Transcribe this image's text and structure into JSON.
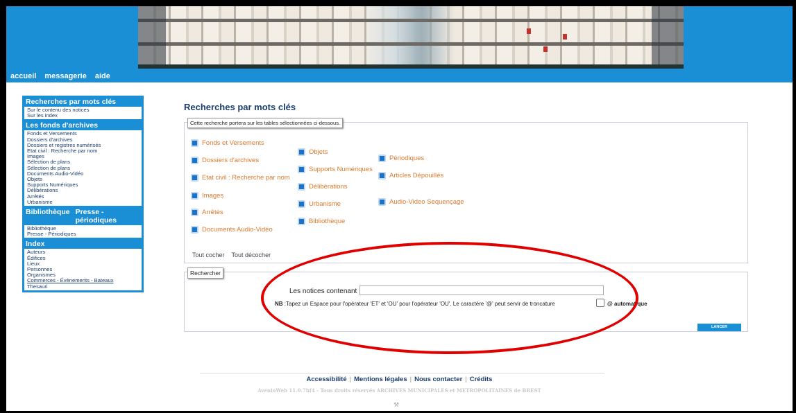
{
  "topnav": [
    "accueil",
    "messagerie",
    "aide"
  ],
  "sidebar": {
    "sections": [
      {
        "title": "Recherches par mots clés",
        "items": [
          "Sur le contenu des notices",
          "Sur les index"
        ]
      },
      {
        "title": "Les fonds d'archives",
        "items": [
          "Fonds et Versements",
          "Dossiers d'archives",
          "Dossiers et registres numérisés",
          "Etat civil : Recherche par nom",
          "Images",
          "Sélection de plans",
          "Sélection de plans",
          "Documents Audio-Vidéo",
          "Objets",
          "Supports Numériques",
          "Délibérations",
          "Arrêtés",
          "Urbanisme"
        ]
      },
      {
        "title_left": "Bibliothèque",
        "title_right": "Presse - périodiques",
        "items": [
          "Bibliothèque",
          "Presse - Périodiques"
        ]
      },
      {
        "title": "Index",
        "items": [
          "Auteurs",
          "Édifices",
          "Lieux",
          "Personnes",
          "Organismes",
          "Commerces - Évènements - Bateaux",
          "Thesauri"
        ]
      }
    ]
  },
  "main": {
    "title": "Recherches par mots clés",
    "tables_legend": "Cette recherche portera sur les tables sélectionnées ci-dessous.",
    "options": {
      "col1": [
        "Fonds et Versements",
        "Dossiers d'archives",
        "Etat civil : Recherche par nom",
        "Images",
        "Arrêtés",
        "Documents Audio-Vidéo"
      ],
      "col2": [
        "Objets",
        "Supports Numériques",
        "Délibérations",
        "Urbanisme",
        "Bibliothèque"
      ],
      "col3": [
        "Périodiques",
        "Articles Dépouillés",
        "Audio-Video Sequençage"
      ]
    },
    "check_all": "Tout cocher",
    "uncheck_all": "Tout décocher",
    "search_legend": "Rechercher",
    "notices_label": "Les notices contenant",
    "search_value": "",
    "nb_prefix": "NB",
    "nb_text": ":Tapez un Espace pour l'opérateur 'ET' et 'OU' pour l'opérateur 'OU'. Le caractère '@' peut servir de troncature",
    "auto_label": "@ automatique",
    "submit_label": "LANCER"
  },
  "footer": {
    "links": [
      "Accessibilité",
      "Mentions légales",
      "Nous contacter",
      "Crédits"
    ],
    "copyright": "AvenioWeb 11.0.7hf4 - Tous droits réservés ARCHIVES MUNICIPALES et METROPOLITAINES de BREST",
    "tools_icon": "tools-icon"
  },
  "colors": {
    "header": "#1a8fd6",
    "option_text": "#e07a2e",
    "annotation": "#e00000"
  }
}
